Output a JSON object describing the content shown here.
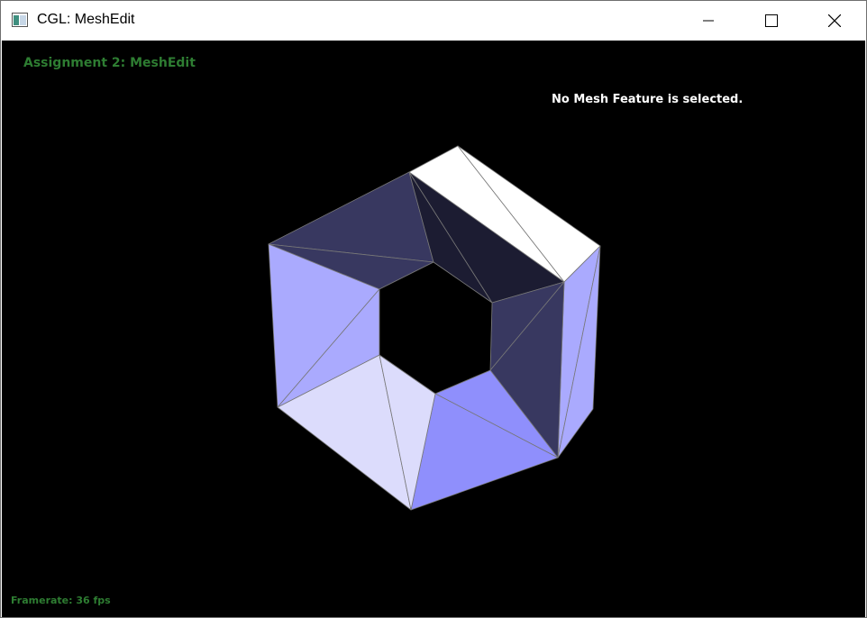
{
  "window": {
    "title": "CGL: MeshEdit",
    "app_icon": "cgl-app-icon",
    "controls": [
      "minimize-icon",
      "maximize-icon",
      "close-icon"
    ]
  },
  "viewport": {
    "heading": "Assignment 2: MeshEdit",
    "status_message": "No Mesh Feature is selected.",
    "framerate": "Framerate: 36 fps",
    "colors": {
      "background": "#000000",
      "heading": "#2e7d32",
      "status": "#ffffff",
      "edge": "#777777",
      "face_white": "#ffffff",
      "face_light": "#dcdcfc",
      "face_lilac": "#aaaafe",
      "face_blue": "#8f8ffc",
      "face_navy": "#383860",
      "face_dark": "#1c1c32"
    }
  }
}
